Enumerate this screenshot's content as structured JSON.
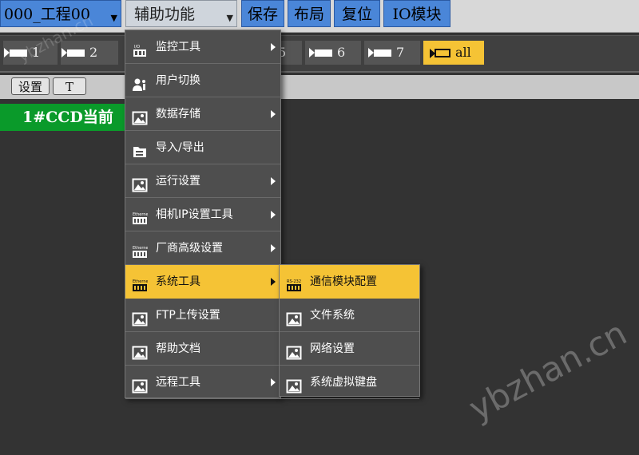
{
  "toolbar": {
    "project": "000_工程00",
    "aux": "辅助功能",
    "save": "保存",
    "layout": "布局",
    "reset": "复位",
    "io": "IO模块"
  },
  "cameras": [
    "1",
    "2",
    "5",
    "6",
    "7",
    "all"
  ],
  "settings": {
    "setup": "设置",
    "t": "T"
  },
  "ccd_label": "1#CCD当前",
  "menu": {
    "items": [
      {
        "label": "监控工具",
        "icon": "io-board-icon",
        "submenu": true
      },
      {
        "label": "用户切换",
        "icon": "user-switch-icon",
        "submenu": false
      },
      {
        "label": "数据存储",
        "icon": "image-icon",
        "submenu": true
      },
      {
        "label": "导入/导出",
        "icon": "import-export-icon",
        "submenu": false
      },
      {
        "label": "运行设置",
        "icon": "image-icon",
        "submenu": true
      },
      {
        "label": "相机IP设置工具",
        "icon": "ethernet-icon",
        "submenu": true
      },
      {
        "label": "厂商高级设置",
        "icon": "ethernet-icon",
        "submenu": true
      },
      {
        "label": "系统工具",
        "icon": "ethernet-icon",
        "submenu": true,
        "highlighted": true
      },
      {
        "label": "FTP上传设置",
        "icon": "image-icon",
        "submenu": false
      },
      {
        "label": "帮助文档",
        "icon": "image-icon",
        "submenu": false
      },
      {
        "label": "远程工具",
        "icon": "image-icon",
        "submenu": true
      }
    ]
  },
  "submenu": {
    "items": [
      {
        "label": "通信模块配置",
        "icon": "rs232-icon",
        "highlighted": true
      },
      {
        "label": "文件系统",
        "icon": "image-icon"
      },
      {
        "label": "网络设置",
        "icon": "image-icon"
      },
      {
        "label": "系统虚拟键盘",
        "icon": "image-icon"
      }
    ]
  },
  "watermark": {
    "main": "ybzhan.cn",
    "top": "ybzhan.cn"
  },
  "colors": {
    "highlight": "#f5c335",
    "toolbar_blue": "#4a86d8",
    "ccd_green": "#0a9a2a"
  }
}
